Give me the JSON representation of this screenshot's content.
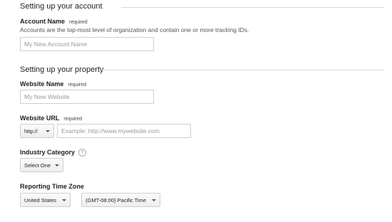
{
  "account_section": {
    "title": "Setting up your account",
    "account_name": {
      "label": "Account Name",
      "required": "required",
      "description": "Accounts are the top-most level of organization and contain one or more tracking IDs.",
      "placeholder": "My New Account Name"
    }
  },
  "property_section": {
    "title": "Setting up your property",
    "website_name": {
      "label": "Website Name",
      "required": "required",
      "placeholder": "My New Website"
    },
    "website_url": {
      "label": "Website URL",
      "required": "required",
      "protocol": "http://",
      "placeholder": "Example: http://www.mywebsite.com"
    },
    "industry_category": {
      "label": "Industry Category",
      "help": "?",
      "value": "Select One"
    },
    "time_zone": {
      "label": "Reporting Time Zone",
      "country": "United States",
      "zone": "(GMT-08:00) Pacific Time"
    }
  }
}
